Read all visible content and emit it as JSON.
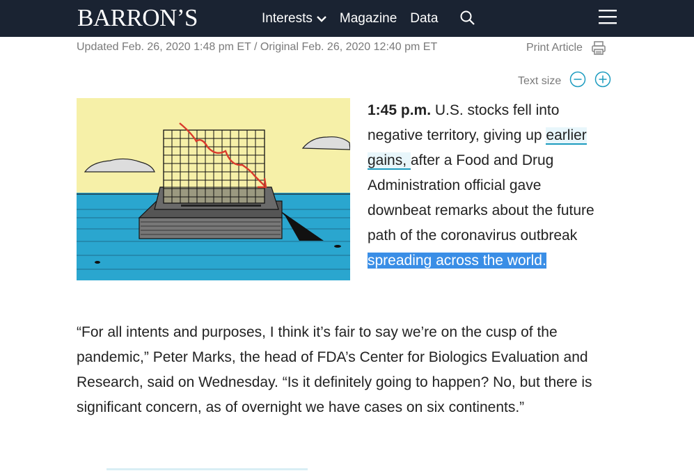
{
  "header": {
    "logo": "BARRON’S",
    "nav": [
      {
        "label": "Interests"
      },
      {
        "label": "Magazine"
      },
      {
        "label": "Data"
      }
    ]
  },
  "article": {
    "dateline": "Updated Feb. 26, 2020 1:48 pm ET / Original Feb. 26, 2020 12:40 pm ET",
    "print_label": "Print Article",
    "text_size_label": "Text size",
    "lead": {
      "time": "1:45 p.m.",
      "part1": " U.S. stocks fell into negative territory, giving up ",
      "link": "earlier gains, ",
      "part2": "after a Food and Drug Administration official gave downbeat remarks about the future path of the coronavirus outbreak",
      "selected": " spreading across the world."
    },
    "quote": "“For all intents and purposes, I think it’s fair to say we’re on the cusp of the pandemic,” Peter Marks, the head of FDA’s Center for Biologics Evaluation and Research, said on Wednesday. “Is it definitely going to happen? No, but there is significant concern, as of overnight we have cases on six continents.”"
  },
  "colors": {
    "header_bg": "#1a2332",
    "link_underline": "#1b9bbf",
    "selection": "#3a8ee6",
    "sky": "#f6f0a8",
    "water": "#2aa6cf"
  }
}
